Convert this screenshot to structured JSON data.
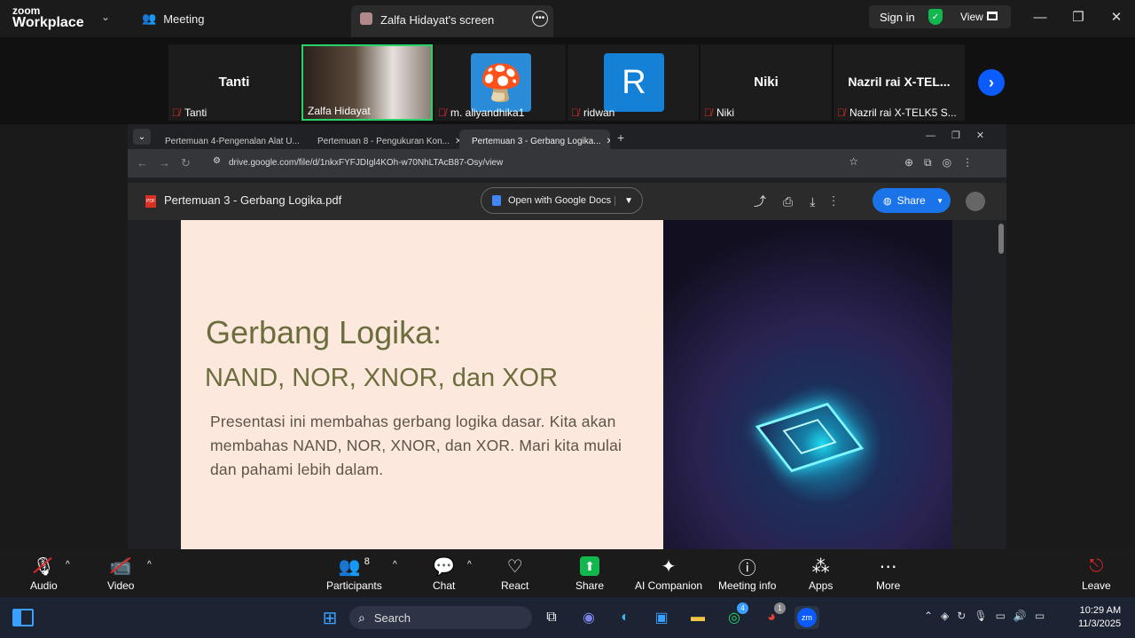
{
  "window": {
    "logo_top": "zoom",
    "logo_bottom": "Workplace",
    "meeting_label": "Meeting",
    "screen_tab_label": "Zalfa Hidayat's screen",
    "sign_in": "Sign in",
    "view": "View"
  },
  "participants_strip": [
    {
      "big": "Tanti",
      "label": "Tanti"
    },
    {
      "big": "",
      "label": "Zalfa Hidayat"
    },
    {
      "big": "",
      "label": "m. aliyandhika1"
    },
    {
      "big": "R",
      "label": "ridwan"
    },
    {
      "big": "Niki",
      "label": "Niki"
    },
    {
      "big": "Nazril rai  X-TEL...",
      "label": "Nazril rai  X-TELK5 S..."
    }
  ],
  "browser": {
    "tabs": [
      {
        "label": "Pertemuan 4-Pengenalan Alat U..."
      },
      {
        "label": "Pertemuan 8 - Pengukuran Kon..."
      },
      {
        "label": "Pertemuan 3 - Gerbang Logika..."
      }
    ],
    "url": "drive.google.com/file/d/1nkxFYFJDIgl4KOh-w70NhLTAcB87-Osy/view",
    "file_title": "Pertemuan 3 - Gerbang Logika.pdf",
    "pdf_badge": "PDF",
    "open_with": "Open with Google Docs",
    "share": "Share"
  },
  "slide": {
    "title": "Gerbang Logika:",
    "subtitle": "NAND, NOR, XNOR, dan XOR",
    "body": "Presentasi ini membahas gerbang logika dasar. Kita akan membahas NAND, NOR, XNOR, dan XOR. Mari kita mulai dan pahami lebih dalam."
  },
  "toolbar": {
    "audio": "Audio",
    "video": "Video",
    "participants": "Participants",
    "participants_count": "8",
    "chat": "Chat",
    "react": "React",
    "share": "Share",
    "ai_companion": "AI Companion",
    "meeting_info": "Meeting info",
    "apps": "Apps",
    "more": "More",
    "leave": "Leave"
  },
  "taskbar": {
    "search": "Search",
    "whatsapp_badge": "4",
    "chrome_badge": "1",
    "zoom_icon": "zm",
    "time": "10:29 AM",
    "date": "11/3/2025"
  },
  "colors": {
    "share_green": "#12b84d",
    "mic_off_red": "#e02828",
    "chrome_share_blue": "#1a73e8",
    "slide_bg": "#fde8dd",
    "slide_title": "#6b6e3c"
  }
}
